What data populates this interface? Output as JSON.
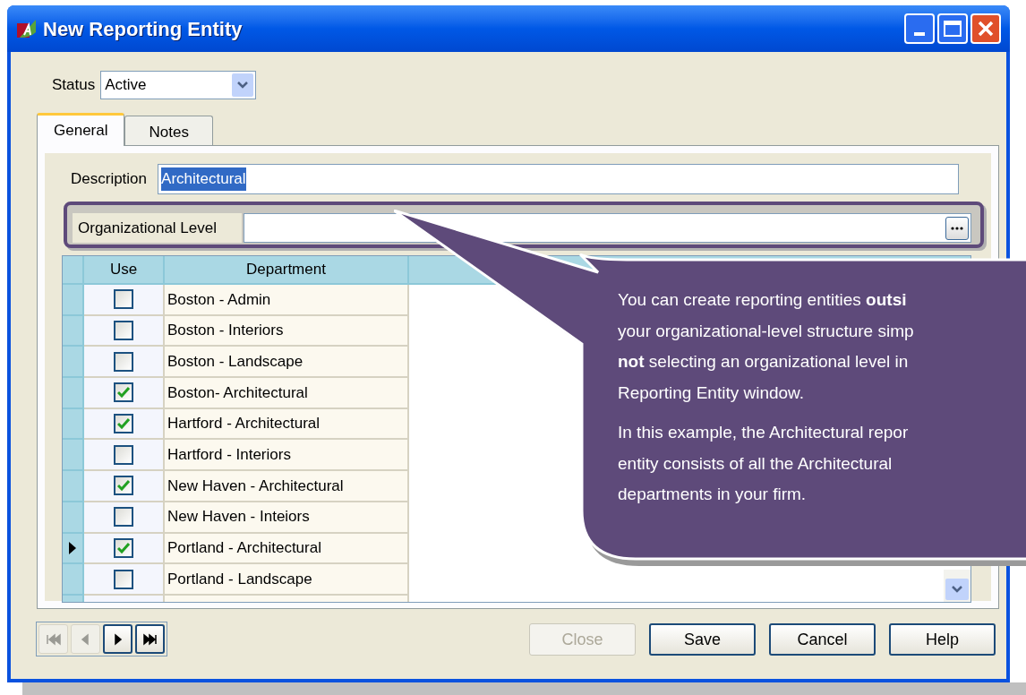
{
  "window": {
    "title": "New Reporting Entity"
  },
  "status": {
    "label": "Status",
    "value": "Active"
  },
  "tabs": [
    {
      "label": "General",
      "selected": true
    },
    {
      "label": "Notes",
      "selected": false
    }
  ],
  "description": {
    "label": "Description",
    "value": "Architectural",
    "text_selected": true
  },
  "organizational_level": {
    "label": "Organizational Level",
    "highlighted": true
  },
  "grid": {
    "columns": [
      "Use",
      "Department"
    ],
    "rows": [
      {
        "use": false,
        "department": "Boston - Admin",
        "current": false
      },
      {
        "use": false,
        "department": "Boston - Interiors",
        "current": false
      },
      {
        "use": false,
        "department": "Boston - Landscape",
        "current": false
      },
      {
        "use": true,
        "department": "Boston- Architectural",
        "current": false
      },
      {
        "use": true,
        "department": "Hartford - Architectural",
        "current": false
      },
      {
        "use": false,
        "department": "Hartford - Interiors",
        "current": false
      },
      {
        "use": true,
        "department": "New Haven - Architectural",
        "current": false
      },
      {
        "use": false,
        "department": "New Haven - Inteiors",
        "current": false
      },
      {
        "use": true,
        "department": "Portland - Architectural",
        "current": true
      },
      {
        "use": false,
        "department": "Portland - Landscape",
        "current": false
      }
    ]
  },
  "navigation": [
    {
      "kind": "first",
      "disabled": true
    },
    {
      "kind": "previous",
      "disabled": true
    },
    {
      "kind": "next",
      "disabled": false
    },
    {
      "kind": "last",
      "disabled": false
    }
  ],
  "buttons": [
    {
      "label": "Close",
      "disabled": true
    },
    {
      "label": "Save",
      "disabled": false
    },
    {
      "label": "Cancel",
      "disabled": false
    },
    {
      "label": "Help",
      "disabled": false
    }
  ],
  "callout": {
    "paragraphs": [
      [
        "You can create reporting entities **outsi**",
        "your organizational-level structure simp",
        "**not** selecting an organizational level in",
        "Reporting Entity window."
      ],
      [
        "In this example, the Architectural repor",
        "entity consists of all the Architectural",
        "departments in your firm."
      ]
    ]
  }
}
